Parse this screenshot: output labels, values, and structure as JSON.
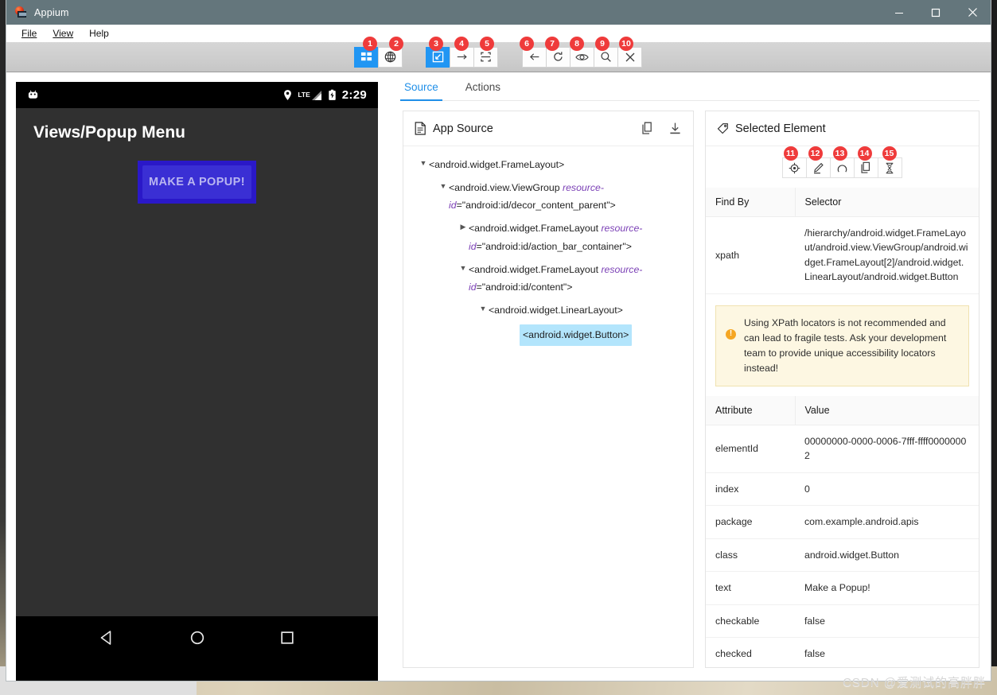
{
  "window": {
    "title": "Appium",
    "icon": "appium-logo-icon",
    "controls": {
      "minimize": "minimize-icon",
      "maximize": "maximize-icon",
      "close": "close-icon"
    }
  },
  "menubar": {
    "items": [
      "File",
      "View",
      "Help"
    ]
  },
  "toolbar": {
    "buttons": [
      {
        "badge": "1",
        "name": "select-elements-mode",
        "icon": "grid-icon",
        "active": true
      },
      {
        "badge": "2",
        "name": "web-native-toggle",
        "icon": "globe-icon",
        "active": false
      },
      {
        "badge": "3",
        "name": "select-element-tool",
        "icon": "cursor-select-icon",
        "active": true
      },
      {
        "badge": "4",
        "name": "swipe-by-coordinates-tool",
        "icon": "arrow-right-icon",
        "active": false
      },
      {
        "badge": "5",
        "name": "tap-by-coordinates-tool",
        "icon": "crop-frame-icon",
        "active": false
      },
      {
        "badge": "6",
        "name": "back-button",
        "icon": "arrow-back-icon",
        "active": false
      },
      {
        "badge": "7",
        "name": "refresh-source-button",
        "icon": "refresh-icon",
        "active": false
      },
      {
        "badge": "8",
        "name": "search-for-element-visibility",
        "icon": "eye-icon",
        "active": false
      },
      {
        "badge": "9",
        "name": "search-for-element-button",
        "icon": "magnifier-icon",
        "active": false
      },
      {
        "badge": "10",
        "name": "quit-session-button",
        "icon": "x-icon",
        "active": false
      }
    ]
  },
  "device": {
    "status_bar": {
      "android_icon": "android-robot-icon",
      "location_icon": "location-pin-icon",
      "signal_label": "LTE",
      "signal_icon": "signal-bars-icon",
      "battery_icon": "battery-charging-icon",
      "time": "2:29"
    },
    "app_bar_title": "Views/Popup Menu",
    "button_label": "MAKE A POPUP!",
    "nav": {
      "back": "triangle-back-icon",
      "home": "circle-home-icon",
      "recents": "square-recents-icon"
    }
  },
  "tabs": [
    {
      "label": "Source",
      "active": true
    },
    {
      "label": "Actions",
      "active": false
    }
  ],
  "source_panel": {
    "title": "App Source",
    "title_icon": "document-icon",
    "actions": [
      {
        "name": "copy-source-button",
        "icon": "copy-icon"
      },
      {
        "name": "download-source-button",
        "icon": "download-icon"
      }
    ],
    "tree": [
      {
        "depth": 0,
        "caret": "down",
        "tag": "<android.widget.FrameLayout>",
        "attr": "",
        "value": "",
        "selected": false
      },
      {
        "depth": 1,
        "caret": "down",
        "tag": "<android.view.ViewGroup ",
        "attr": "resource-id",
        "value": "=\"android:id/decor_content_parent\">",
        "selected": false
      },
      {
        "depth": 2,
        "caret": "right",
        "tag": "<android.widget.FrameLayout ",
        "attr": "resource-id",
        "value": "=\"android:id/action_bar_container\">",
        "selected": false
      },
      {
        "depth": 2,
        "caret": "down",
        "tag": "<android.widget.FrameLayout ",
        "attr": "resource-id",
        "value": "=\"android:id/content\">",
        "selected": false
      },
      {
        "depth": 3,
        "caret": "down",
        "tag": "<android.widget.LinearLayout>",
        "attr": "",
        "value": "",
        "selected": false
      },
      {
        "depth": 4,
        "caret": "none",
        "tag": "<android.widget.Button>",
        "attr": "",
        "value": "",
        "selected": true
      }
    ]
  },
  "selected_panel": {
    "title": "Selected Element",
    "title_icon": "tag-icon",
    "actions": [
      {
        "badge": "11",
        "name": "tap-element-button",
        "icon": "crosshair-icon"
      },
      {
        "badge": "12",
        "name": "send-keys-button",
        "icon": "pencil-icon"
      },
      {
        "badge": "13",
        "name": "clear-element-button",
        "icon": "undo-arc-icon"
      },
      {
        "badge": "14",
        "name": "copy-attributes-button",
        "icon": "copy-icon"
      },
      {
        "badge": "15",
        "name": "get-timing-button",
        "icon": "hourglass-icon"
      }
    ],
    "selector_table": {
      "headers": [
        "Find By",
        "Selector"
      ],
      "rows": [
        {
          "find_by": "xpath",
          "selector": "/hierarchy/android.widget.FrameLayout/android.view.ViewGroup/android.widget.FrameLayout[2]/android.widget.LinearLayout/android.widget.Button"
        }
      ]
    },
    "warning": {
      "icon": "warning-exclamation-icon",
      "text": "Using XPath locators is not recommended and can lead to fragile tests. Ask your development team to provide unique accessibility locators instead!"
    },
    "attributes_table": {
      "headers": [
        "Attribute",
        "Value"
      ],
      "rows": [
        {
          "attribute": "elementId",
          "value": "00000000-0000-0006-7fff-ffff00000002"
        },
        {
          "attribute": "index",
          "value": "0"
        },
        {
          "attribute": "package",
          "value": "com.example.android.apis"
        },
        {
          "attribute": "class",
          "value": "android.widget.Button"
        },
        {
          "attribute": "text",
          "value": "Make a Popup!"
        },
        {
          "attribute": "checkable",
          "value": "false"
        },
        {
          "attribute": "checked",
          "value": "false"
        }
      ]
    }
  },
  "watermark": "CSDN @爱测试的高胖胖",
  "colors": {
    "titlebar": "#64767c",
    "accent_blue": "#2196f3",
    "badge_red": "#ef3b3b",
    "tree_selected": "#b3e5fc",
    "warning_bg": "#fdf7e2",
    "device_button": "#3a2fd4"
  }
}
